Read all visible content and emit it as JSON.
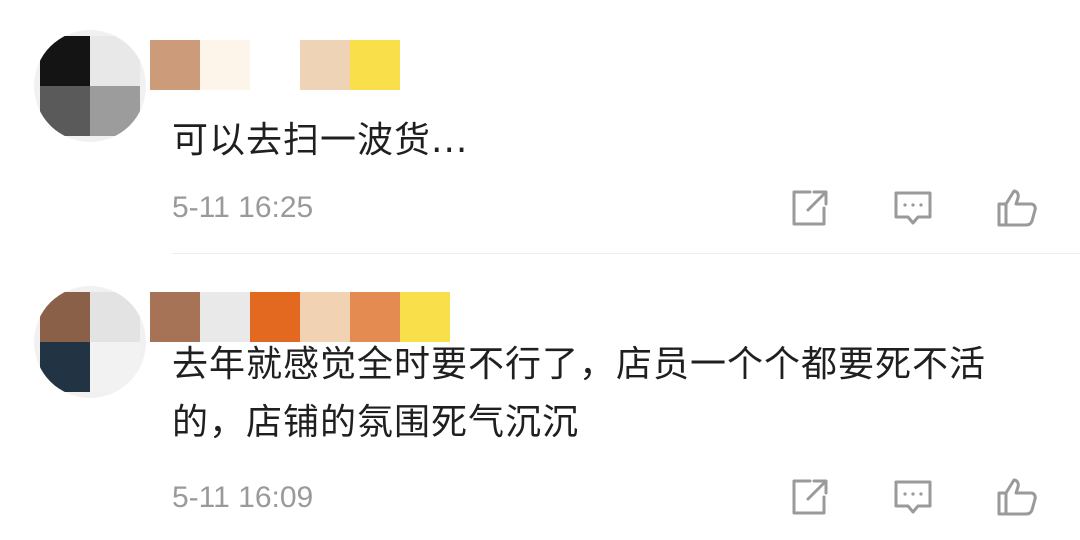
{
  "comments": [
    {
      "avatar_colors": [
        "#141414",
        "#e8e8e8",
        "#5a5a5a",
        "#9c9c9c"
      ],
      "username_blocks": [
        "#cc9b7a",
        "#fdf5ea",
        "#ffffff",
        "#efd3b6",
        "#f9e04a"
      ],
      "text": "可以去扫一波货...",
      "time": "5-11 16:25",
      "actions": {
        "share": "share-icon",
        "reply": "reply-icon",
        "like": "like-icon"
      }
    },
    {
      "avatar_colors": [
        "#8a6048",
        "#e3e3e3",
        "#223344",
        "#f2f2f2"
      ],
      "username_blocks": [
        "#a67356",
        "#e9e9e9",
        "#e2691f",
        "#f1d2b2",
        "#e38b50",
        "#f9df4a"
      ],
      "text": "去年就感觉全时要不行了，店员一个个都要死不活的，店铺的氛围死气沉沉",
      "time": "5-11 16:09",
      "actions": {
        "share": "share-icon",
        "reply": "reply-icon",
        "like": "like-icon"
      }
    }
  ],
  "colors": {
    "text": "#1f1f1f",
    "meta": "#9a9a9a",
    "icon": "#9a9a9a",
    "divider": "#ececec"
  }
}
